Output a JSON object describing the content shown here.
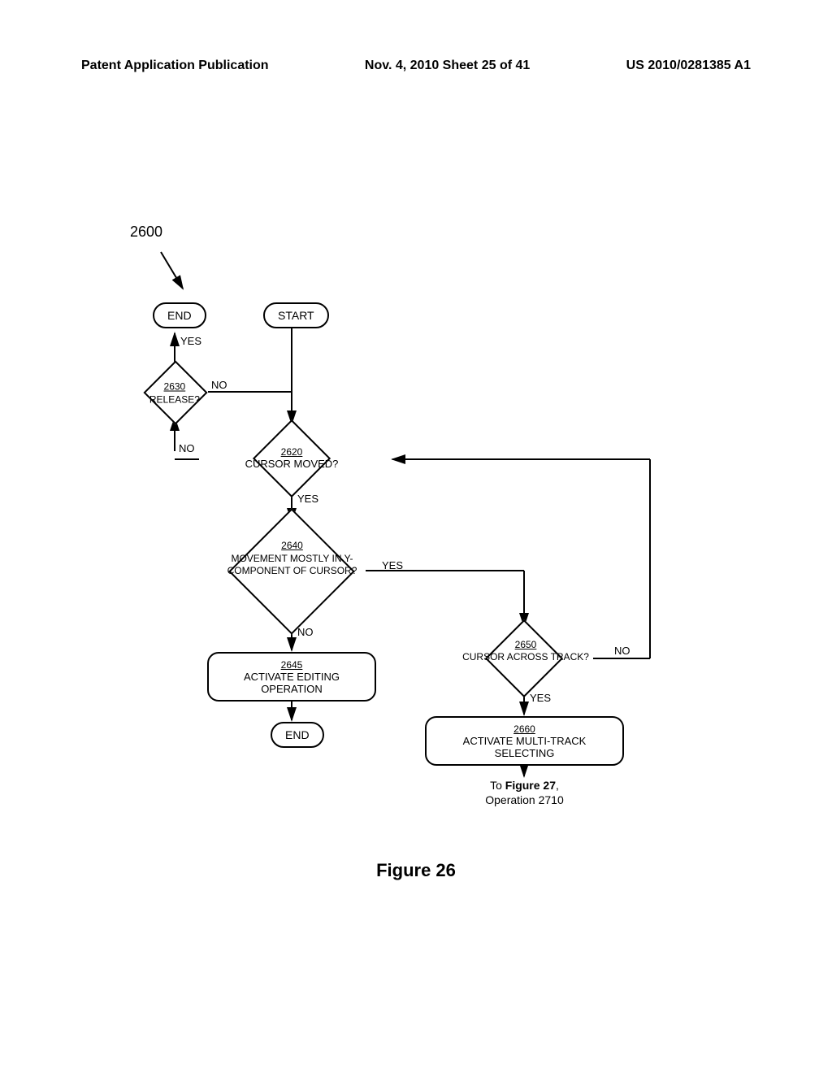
{
  "header": {
    "left": "Patent Application Publication",
    "center": "Nov. 4, 2010  Sheet 25 of 41",
    "right": "US 2010/0281385 A1"
  },
  "figure": {
    "number": "2600",
    "caption": "Figure 26"
  },
  "nodes": {
    "start": "START",
    "end1": "END",
    "end2": "END",
    "release": {
      "ref": "2630",
      "text": "RELEASE?"
    },
    "cursor_moved": {
      "ref": "2620",
      "text": "CURSOR MOVED?"
    },
    "movement": {
      "ref": "2640",
      "text": "MOVEMENT MOSTLY IN Y-COMPONENT OF CURSOR?"
    },
    "across": {
      "ref": "2650",
      "text": "CURSOR ACROSS TRACK?"
    },
    "editing": {
      "ref": "2645",
      "text": "ACTIVATE EDITING OPERATION"
    },
    "multitrack": {
      "ref": "2660",
      "text": "ACTIVATE MULTI-TRACK SELECTING"
    }
  },
  "labels": {
    "yes": "YES",
    "no": "NO"
  },
  "goto": {
    "line1": "To Figure 27,",
    "line2": "Operation 2710"
  }
}
